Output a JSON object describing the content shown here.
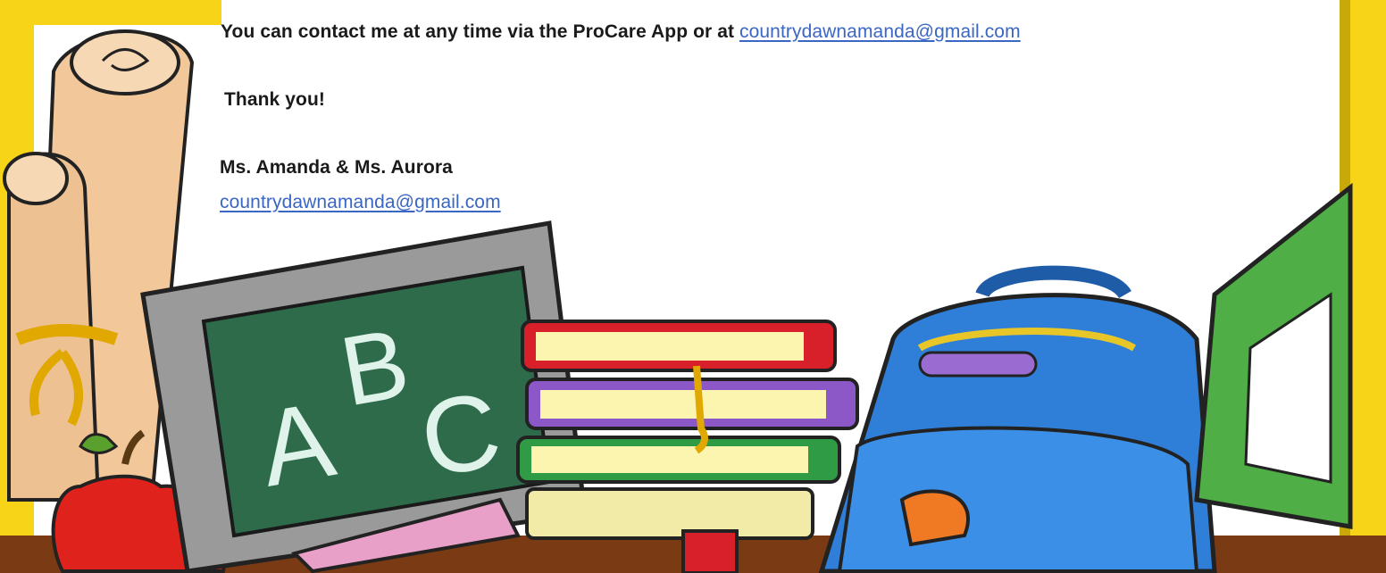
{
  "letter": {
    "contact_text": "You can contact me at any time via the ProCare App or at ",
    "contact_email": "countrydawnamanda@gmail.com",
    "thanks": "Thank you!",
    "signature": "Ms. Amanda & Ms. Aurora",
    "signature_email": "countrydawnamanda@gmail.com"
  },
  "illustration": {
    "chalkboard_letters": [
      "A",
      "B",
      "C"
    ]
  },
  "colors": {
    "frame_yellow": "#f7d417",
    "chalkboard_green": "#2e6b4a",
    "backpack_blue": "#2f7fd9",
    "link_blue": "#3a66c4"
  }
}
